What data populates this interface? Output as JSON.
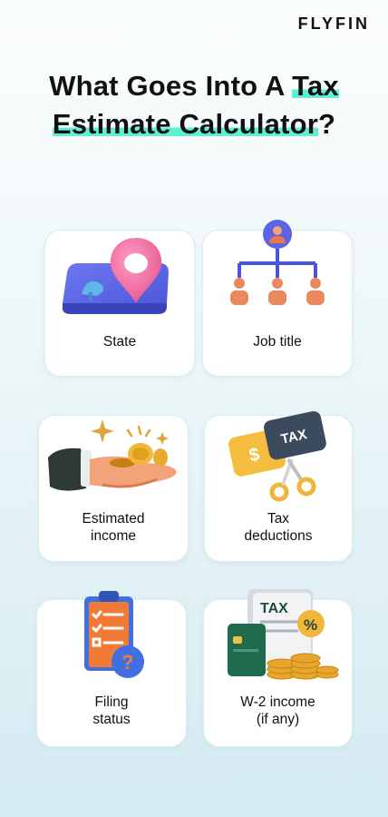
{
  "brand": "FLYFIN",
  "title": {
    "part1": "What Goes Into A ",
    "highlight1": "Tax",
    "highlight2": "Estimate Calculator",
    "end": "?"
  },
  "cards": [
    {
      "icon": "map-pin-icon",
      "lines": [
        "State"
      ]
    },
    {
      "icon": "org-chart-icon",
      "lines": [
        "Job title"
      ]
    },
    {
      "icon": "hand-coins-icon",
      "lines": [
        "Estimated",
        "income"
      ]
    },
    {
      "icon": "tax-scissors-icon",
      "lines": [
        "Tax",
        "deductions"
      ]
    },
    {
      "icon": "clipboard-question-icon",
      "lines": [
        "Filing",
        "status"
      ]
    },
    {
      "icon": "tax-document-coins-icon",
      "lines": [
        "W-2 income",
        "(if any)"
      ]
    }
  ],
  "colors": {
    "highlight": "#5ff0d4",
    "accent_orange": "#f17b3a",
    "accent_blue": "#3f6fe0"
  }
}
